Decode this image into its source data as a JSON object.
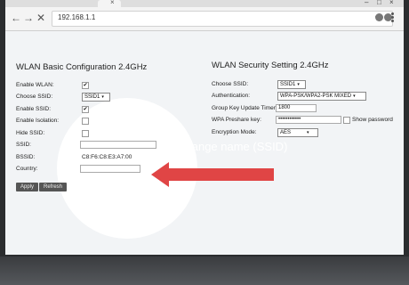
{
  "browser": {
    "url": "192.168.1.1",
    "back_icon": "back-arrow-icon",
    "forward_icon": "forward-arrow-icon",
    "close_icon": "close-icon"
  },
  "wlan_basic": {
    "title": "WLAN Basic Configuration 2.4GHz",
    "rows": [
      {
        "label": "Enable WLAN:"
      },
      {
        "label": "Choose SSID:"
      },
      {
        "label": "Enable SSID:"
      },
      {
        "label": "Enable Isolation:"
      },
      {
        "label": "Hide SSID:"
      },
      {
        "label": "SSID:"
      },
      {
        "label": "BSSID:"
      },
      {
        "label": "Country:"
      }
    ],
    "ssid_select": "SSID1",
    "bssid": "C8:F6:C8:E3:A7:00",
    "apply": "Apply",
    "refresh": "Refresh"
  },
  "wlan_security": {
    "title": "WLAN Security Setting 2.4GHz",
    "rows": [
      {
        "label": "Choose SSID:"
      },
      {
        "label": "Authentication:"
      },
      {
        "label": "Group Key Update Timer:"
      },
      {
        "label": "WPA Preshare key:"
      },
      {
        "label": "Encryption Mode:"
      }
    ],
    "ssid_select": "SSID1",
    "authentication": "WPA-PSK/WPA2-PSK MIXED",
    "group_key_timer": "1800",
    "preshare_key": "••••••••••••",
    "show_password": "Show password",
    "encryption_mode": "AES"
  },
  "annotation": {
    "text": "change name (SSID)",
    "color": "#e04545"
  }
}
